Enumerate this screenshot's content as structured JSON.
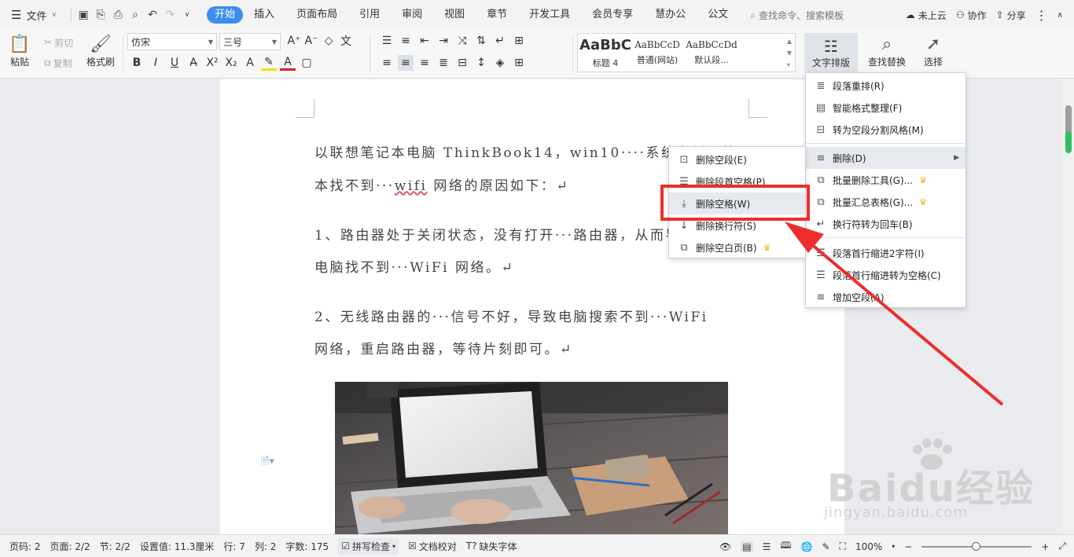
{
  "menubar": {
    "file_label": "文件",
    "tabs": [
      "开始",
      "插入",
      "页面布局",
      "引用",
      "审阅",
      "视图",
      "章节",
      "开发工具",
      "会员专享",
      "慧办公",
      "公文"
    ],
    "active_tab": "开始",
    "search_placeholder": "查找命令、搜索模板",
    "cloud_label": "未上云",
    "collab_label": "协作",
    "share_label": "分享",
    "accent_color": "#3b8ef0"
  },
  "ribbon": {
    "paste": "粘贴",
    "cut": "剪切",
    "copy": "复制",
    "format_painter": "格式刷",
    "font_name": "仿宋",
    "font_size": "三号",
    "styles": [
      {
        "preview": "AaBbC",
        "name": "标题 4"
      },
      {
        "preview": "AaBbCcD",
        "name": "普通(网站)"
      },
      {
        "preview": "AaBbCcDd",
        "name": "默认段..."
      }
    ],
    "text_layout": "文字排版",
    "find_replace": "查找替换",
    "select": "选择"
  },
  "document": {
    "paragraphs": [
      {
        "pre": "以联想笔记本电脑 ThinkBook14，win10····系统为例，笔记",
        "wavy": "",
        "post": ""
      },
      {
        "pre": "本找不到···",
        "wavy": "wifi",
        "post": " 网络的原因如下：↵"
      },
      {
        "pre": "1、路由器处于关闭状态，没有打开···路由器，从而导致",
        "wavy": "",
        "post": ""
      },
      {
        "pre": "电脑找不到···WiFi 网络。↵",
        "wavy": "",
        "post": ""
      },
      {
        "pre": "2、无线路由器的···信号不好，导致电脑搜索不到···WiFi",
        "wavy": "",
        "post": ""
      },
      {
        "pre": "网络，重启路由器，等待片刻即可。↵",
        "wavy": "",
        "post": ""
      }
    ]
  },
  "menu_main": {
    "items": [
      {
        "label": "段落重排(R)",
        "icon": "reflow-icon"
      },
      {
        "label": "智能格式整理(F)",
        "icon": "smart-format-icon"
      },
      {
        "label": "转为空段分割风格(M)",
        "icon": "split-style-icon"
      },
      {
        "label": "删除(D)",
        "icon": "delete-format-icon"
      },
      {
        "label": "批量删除工具(G)...",
        "icon": "batch-delete-icon"
      },
      {
        "label": "批量汇总表格(G)...",
        "icon": "batch-table-icon"
      },
      {
        "label": "换行符转为回车(B)",
        "icon": "linebreak-icon"
      },
      {
        "label": "段落首行缩进2字符(I)",
        "icon": "indent-icon"
      },
      {
        "label": "段落首行缩进转为空格(C)",
        "icon": "indent-space-icon"
      },
      {
        "label": "增加空段(A)",
        "icon": "add-para-icon"
      }
    ]
  },
  "menu_sub": {
    "items": [
      {
        "label": "删除空段(E)"
      },
      {
        "label": "删除段首空格(P)"
      },
      {
        "label": "删除空格(W)"
      },
      {
        "label": "删除换行符(S)"
      },
      {
        "label": "删除空白页(B)"
      }
    ]
  },
  "statusbar": {
    "page_code": "页码: 2",
    "pages": "页面: 2/2",
    "section": "节: 2/2",
    "setting": "设置值: 11.3厘米",
    "row": "行: 7",
    "col": "列: 2",
    "words": "字数: 175",
    "spell_check": "拼写检查",
    "doc_check": "文档校对",
    "missing_font": "缺失字体",
    "zoom": "100%"
  },
  "watermark": {
    "brand": "Baidu经验",
    "url": "jingyan.baidu.com"
  }
}
